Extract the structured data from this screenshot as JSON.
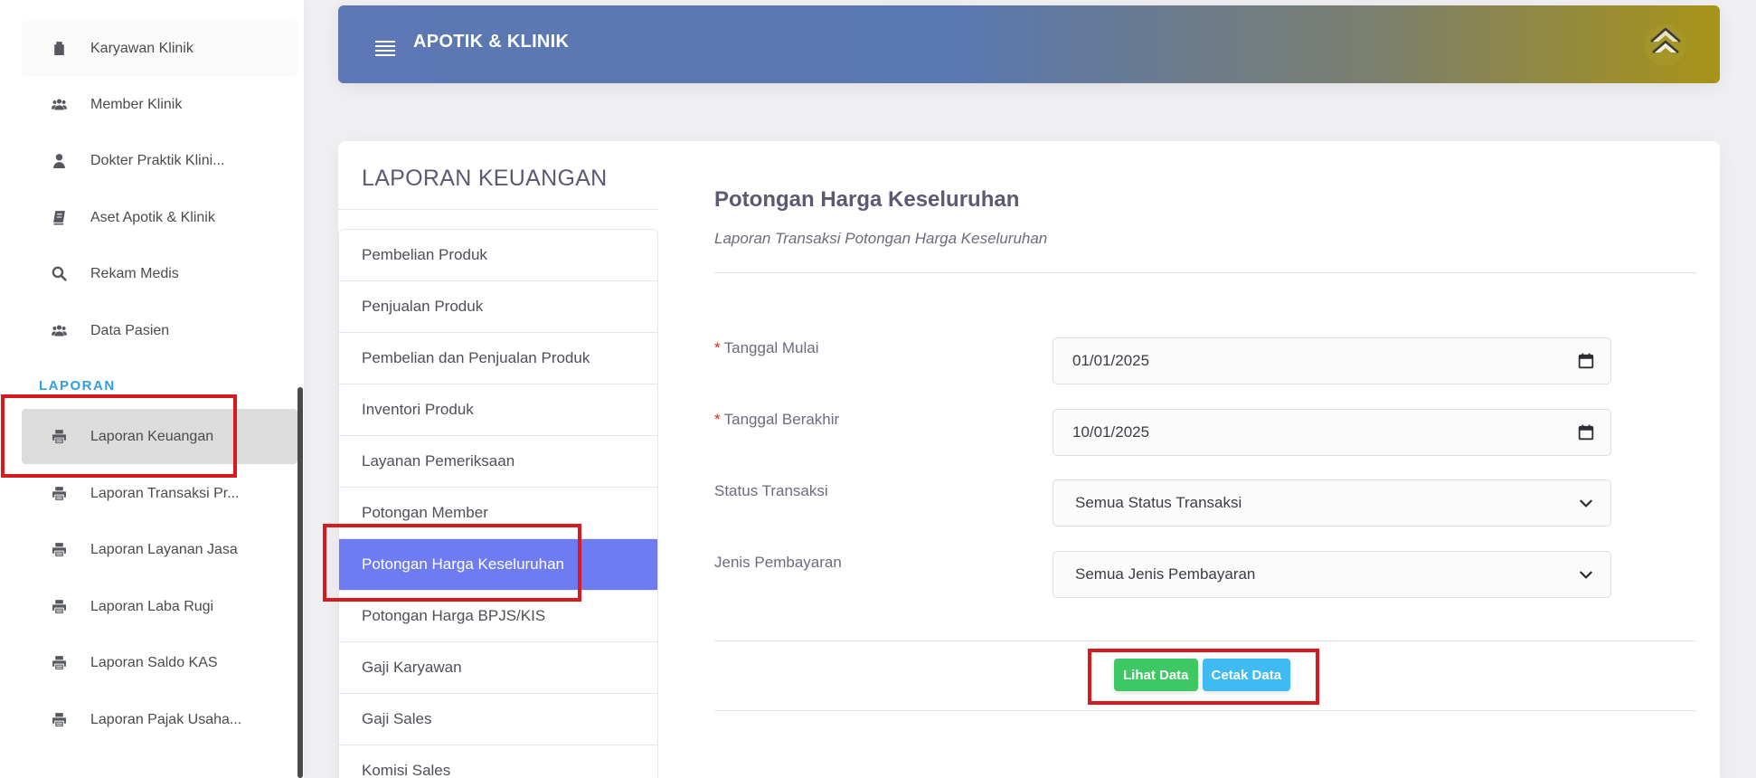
{
  "sidebar": {
    "items": [
      {
        "label": "Karyawan Klinik",
        "icon": "badge-icon"
      },
      {
        "label": "Member Klinik",
        "icon": "users-icon"
      },
      {
        "label": "Dokter Praktik Klini...",
        "icon": "user-icon"
      },
      {
        "label": "Aset Apotik & Klinik",
        "icon": "book-icon"
      },
      {
        "label": "Rekam Medis",
        "icon": "search-icon"
      },
      {
        "label": "Data Pasien",
        "icon": "users-icon"
      }
    ],
    "section_label": "LAPORAN",
    "report_items": [
      {
        "label": "Laporan Keuangan",
        "icon": "printer-icon"
      },
      {
        "label": "Laporan Transaksi Pr...",
        "icon": "printer-icon"
      },
      {
        "label": "Laporan Layanan Jasa",
        "icon": "printer-icon"
      },
      {
        "label": "Laporan Laba Rugi",
        "icon": "printer-icon"
      },
      {
        "label": "Laporan Saldo KAS",
        "icon": "printer-icon"
      },
      {
        "label": "Laporan Pajak Usaha...",
        "icon": "printer-icon"
      }
    ],
    "active_item": "Laporan Keuangan"
  },
  "header": {
    "title": "APOTIK & KLINIK",
    "menu_icon": "hamburger-icon",
    "brand_icon": "brand-logo-icon"
  },
  "card": {
    "title": "LAPORAN KEUANGAN",
    "report_types": [
      "Pembelian Produk",
      "Penjualan Produk",
      "Pembelian dan Penjualan Produk",
      "Inventori Produk",
      "Layanan Pemeriksaan",
      "Potongan Member",
      "Potongan Harga Keseluruhan",
      "Potongan Harga BPJS/KIS",
      "Gaji Karyawan",
      "Gaji Sales",
      "Komisi Sales"
    ],
    "active_report": "Potongan Harga Keseluruhan"
  },
  "form": {
    "title": "Potongan Harga Keseluruhan",
    "subtitle": "Laporan Transaksi Potongan Harga Keseluruhan",
    "required_mark": "*",
    "start_date": {
      "label": "Tanggal Mulai",
      "value": "01/01/2025"
    },
    "end_date": {
      "label": "Tanggal Berakhir",
      "value": "10/01/2025"
    },
    "status": {
      "label": "Status Transaksi",
      "value": "Semua Status Transaksi"
    },
    "payment": {
      "label": "Jenis Pembayaran",
      "value": "Semua Jenis Pembayaran"
    },
    "view_button": "Lihat Data",
    "print_button": "Cetak Data"
  },
  "colors": {
    "accent": "#6f7bf0",
    "highlight": "#d81920",
    "section": "#2f9de8",
    "btn_view": "#3ec864",
    "btn_print": "#3fbaf2"
  }
}
